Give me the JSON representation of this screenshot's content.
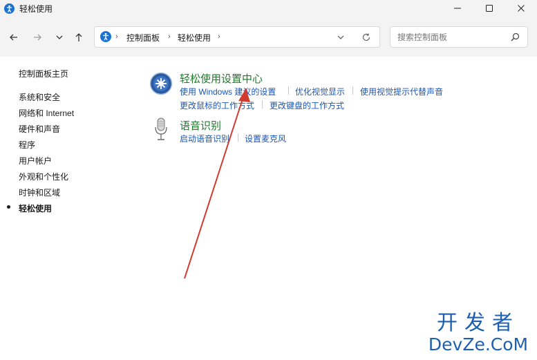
{
  "window": {
    "title": "轻松使用",
    "icon": "accessibility-icon",
    "controls": [
      "minimize-icon",
      "maximize-icon",
      "close-icon"
    ]
  },
  "nav": {
    "back": "arrow-left-icon",
    "forward": "arrow-right-icon",
    "recent": "chevron-down-icon",
    "up": "arrow-up-icon",
    "breadcrumb": [
      "控制面板",
      "轻松使用"
    ],
    "search": {
      "placeholder": "搜索控制面板",
      "value": ""
    }
  },
  "sidebar": {
    "home": "控制面板主页",
    "items": [
      {
        "label": "系统和安全",
        "active": false
      },
      {
        "label": "网络和 Internet",
        "active": false
      },
      {
        "label": "硬件和声音",
        "active": false
      },
      {
        "label": "程序",
        "active": false
      },
      {
        "label": "用户帐户",
        "active": false
      },
      {
        "label": "外观和个性化",
        "active": false
      },
      {
        "label": "时钟和区域",
        "active": false
      },
      {
        "label": "轻松使用",
        "active": true
      }
    ]
  },
  "categories": [
    {
      "title": "轻松使用设置中心",
      "icon": "ease-of-access-center-icon",
      "links": [
        "使用 Windows 建议的设置",
        "优化视觉显示",
        "使用视觉提示代替声音",
        "更改鼠标的工作方式",
        "更改键盘的工作方式"
      ]
    },
    {
      "title": "语音识别",
      "icon": "microphone-icon",
      "links": [
        "启动语音识别",
        "设置麦克风"
      ]
    }
  ],
  "watermark": {
    "line1": "开发者",
    "line2": "DevZe.CoM"
  },
  "colors": {
    "category": "#1e7a2a",
    "link": "#1a56b5",
    "annotation": "#d23a2f",
    "chrome": "#f3f3f3"
  }
}
